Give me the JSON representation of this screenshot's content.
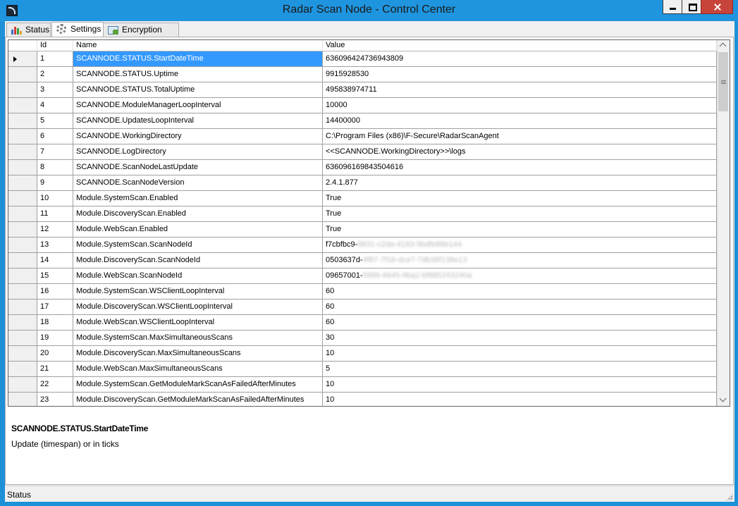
{
  "window": {
    "title": "Radar Scan Node - Control Center"
  },
  "tabs": [
    {
      "label": "Status",
      "icon": "bar-chart-icon"
    },
    {
      "label": "Settings",
      "icon": "gear-icon"
    },
    {
      "label": "Encryption keys",
      "icon": "key-certificate-icon"
    }
  ],
  "grid": {
    "columns": {
      "id": "Id",
      "name": "Name",
      "value": "Value"
    },
    "selected_row": 0,
    "rows": [
      {
        "id": "1",
        "name": "SCANNODE.STATUS.StartDateTime",
        "value": "636096424736943809"
      },
      {
        "id": "2",
        "name": "SCANNODE.STATUS.Uptime",
        "value": "9915928530"
      },
      {
        "id": "3",
        "name": "SCANNODE.STATUS.TotalUptime",
        "value": "495838974711"
      },
      {
        "id": "4",
        "name": "SCANNODE.ModuleManagerLoopInterval",
        "value": "10000"
      },
      {
        "id": "5",
        "name": "SCANNODE.UpdatesLoopInterval",
        "value": "14400000"
      },
      {
        "id": "6",
        "name": "SCANNODE.WorkingDirectory",
        "value": "C:\\Program Files (x86)\\F-Secure\\RadarScanAgent"
      },
      {
        "id": "7",
        "name": "SCANNODE.LogDirectory",
        "value": "<<SCANNODE.WorkingDirectory>>\\logs"
      },
      {
        "id": "8",
        "name": "SCANNODE.ScanNodeLastUpdate",
        "value": "636096169843504616"
      },
      {
        "id": "9",
        "name": "SCANNODE.ScanNodeVersion",
        "value": "2.4.1.877"
      },
      {
        "id": "10",
        "name": "Module.SystemScan.Enabled",
        "value": "True"
      },
      {
        "id": "11",
        "name": "Module.DiscoveryScan.Enabled",
        "value": "True"
      },
      {
        "id": "12",
        "name": "Module.WebScan.Enabled",
        "value": "True"
      },
      {
        "id": "13",
        "name": "Module.SystemScan.ScanNodeId",
        "value": "f7cbfbc9-",
        "value_hidden": "8831-c2da-4183-9bdfe88e144"
      },
      {
        "id": "14",
        "name": "Module.DiscoveryScan.ScanNodeId",
        "value": "0503637d-",
        "value_hidden": "4f87-7f18-dce7-7db38f138e13"
      },
      {
        "id": "15",
        "name": "Module.WebScan.ScanNodeId",
        "value": "09657001-",
        "value_hidden": "5886-6645-9ba2-bf885243240a"
      },
      {
        "id": "16",
        "name": "Module.SystemScan.WSClientLoopInterval",
        "value": "60"
      },
      {
        "id": "17",
        "name": "Module.DiscoveryScan.WSClientLoopInterval",
        "value": "60"
      },
      {
        "id": "18",
        "name": "Module.WebScan.WSClientLoopInterval",
        "value": "60"
      },
      {
        "id": "19",
        "name": "Module.SystemScan.MaxSimultaneousScans",
        "value": "30"
      },
      {
        "id": "20",
        "name": "Module.DiscoveryScan.MaxSimultaneousScans",
        "value": "10"
      },
      {
        "id": "21",
        "name": "Module.WebScan.MaxSimultaneousScans",
        "value": "5"
      },
      {
        "id": "22",
        "name": "Module.SystemScan.GetModuleMarkScanAsFailedAfterMinutes",
        "value": "10"
      },
      {
        "id": "23",
        "name": "Module.DiscoveryScan.GetModuleMarkScanAsFailedAfterMinutes",
        "value": "10"
      }
    ]
  },
  "description": {
    "title": "SCANNODE.STATUS.StartDateTime",
    "text": "Update (timespan) or in ticks"
  },
  "statusbar": {
    "text": "Status"
  }
}
